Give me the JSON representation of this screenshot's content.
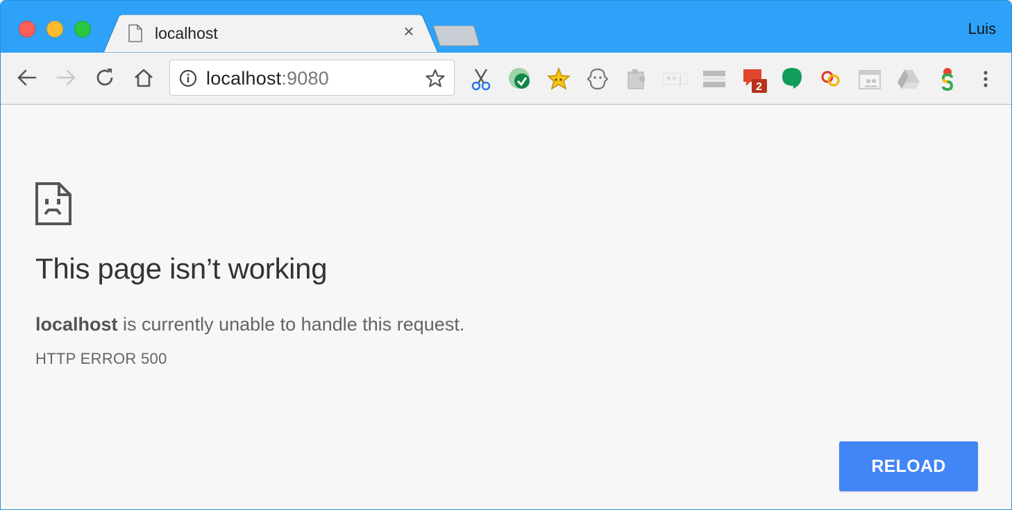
{
  "window": {
    "profile_name": "Luis"
  },
  "tab": {
    "title": "localhost",
    "close_glyph": "×",
    "icon": "document-icon"
  },
  "toolbar": {
    "url_host": "localhost",
    "url_port": ":9080",
    "extensions": [
      "scissors-icon",
      "grammarly-check-icon",
      "star-gold-icon",
      "ghost-icon",
      "puzzle-icon",
      "password-icon",
      "stripes-icon",
      "chat-badge-icon",
      "hangouts-icon",
      "rings-icon",
      "calendar-icon",
      "drive-icon",
      "color-s-icon"
    ],
    "chat_badge_count": "2"
  },
  "content": {
    "heading": "This page isn’t working",
    "message_host": "localhost",
    "message_rest": " is currently unable to handle this request.",
    "error_code": "HTTP ERROR 500",
    "reload_label": "RELOAD"
  },
  "colors": {
    "titlebar": "#2ea2f8",
    "reload_button": "#4285f4"
  }
}
